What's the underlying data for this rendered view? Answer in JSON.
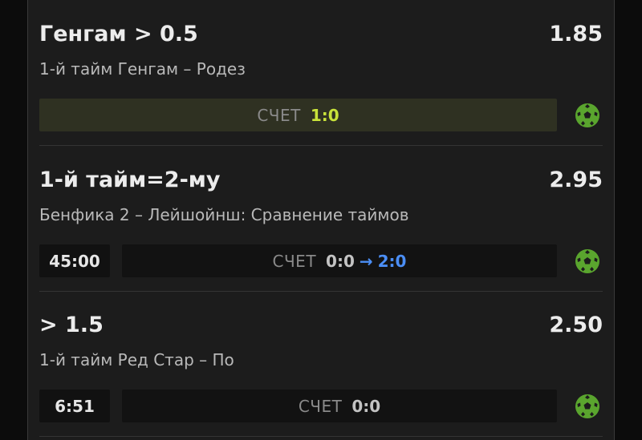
{
  "bets": [
    {
      "title": "Генгам > 0.5",
      "odds": "1.85",
      "subtitle": "1-й тайм Генгам – Родез",
      "score_label": "СЧЕТ",
      "score": "1:0"
    },
    {
      "title": "1-й тайм=2-му",
      "odds": "2.95",
      "subtitle": "Бенфика 2 – Лейшойнш: Сравнение таймов",
      "time": "45:00",
      "score_label": "СЧЕТ",
      "score": "0:0",
      "arrow": "→",
      "score_new": "2:0"
    },
    {
      "title": "> 1.5",
      "odds": "2.50",
      "subtitle": "1-й тайм Ред Стар – По",
      "time": "6:51",
      "score_label": "СЧЕТ",
      "score": "0:0"
    }
  ],
  "colors": {
    "background": "#1c1c1c",
    "win_score": "#c8e23a",
    "ball_icon": "#5aa52e",
    "arrow": "#4b8ef5"
  },
  "icons": {
    "sport": "soccer-ball-icon"
  }
}
